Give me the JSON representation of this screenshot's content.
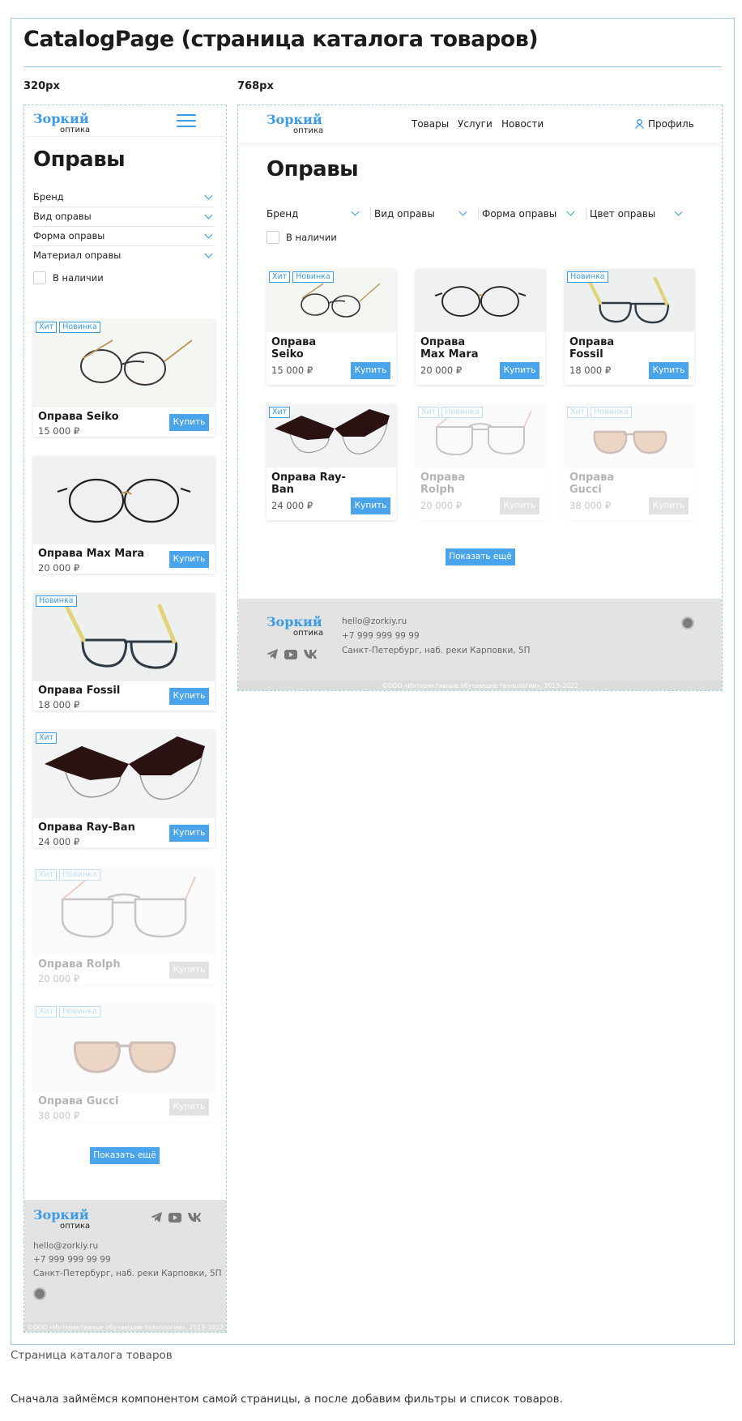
{
  "page_title": "CatalogPage (страница каталога товаров)",
  "widths": {
    "mobile": "320px",
    "tablet": "768px"
  },
  "logo": {
    "name": "Зоркий",
    "sub": "оптика"
  },
  "heading": "Оправы",
  "nav": [
    "Товары",
    "Услуги",
    "Новости"
  ],
  "profile": "Профиль",
  "filters_mobile": [
    "Бренд",
    "Вид оправы",
    "Форма оправы",
    "Материал оправы"
  ],
  "filters_tablet": [
    "Бренд",
    "Вид оправы",
    "Форма оправы",
    "Цвет оправы"
  ],
  "in_stock": "В наличии",
  "buy_label": "Купить",
  "show_more": "Показать ещё",
  "products": [
    {
      "name": "Оправа Seiko",
      "price": "15 000 ₽",
      "badges": [
        "Хит",
        "Новинка"
      ],
      "available": true
    },
    {
      "name": "Оправа Max Mara",
      "price": "20 000 ₽",
      "badges": [],
      "available": true
    },
    {
      "name": "Оправа Fossil",
      "price": "18 000 ₽",
      "badges": [
        "Новинка"
      ],
      "available": true
    },
    {
      "name": "Оправа Ray-Ban",
      "price": "24 000 ₽",
      "badges": [
        "Хит"
      ],
      "available": true
    },
    {
      "name": "Оправа Rolph",
      "price": "20 000 ₽",
      "badges": [
        "Хит",
        "Новинка"
      ],
      "available": false
    },
    {
      "name": "Оправа Gucci",
      "price": "38 000 ₽",
      "badges": [
        "Хит",
        "Новинка"
      ],
      "available": false
    }
  ],
  "tablet_names": [
    [
      "Оправа",
      "Seiko"
    ],
    [
      "Оправа",
      "Max Mara"
    ],
    [
      "Оправа",
      "Fossil"
    ],
    [
      "Оправа Ray-",
      "Ban"
    ],
    [
      "Оправа",
      "Rolph"
    ],
    [
      "Оправа",
      "Gucci"
    ]
  ],
  "footer": {
    "email": "hello@zorkiy.ru",
    "phone": "+7 999 999 99 99",
    "address": "Санкт-Петербург, наб. реки Карповки, 5П",
    "copyright": "©ООО «Интерактивные обучающие технологии», 2013–2022",
    "social": [
      "telegram-icon",
      "youtube-icon",
      "vk-icon"
    ]
  },
  "captions": {
    "figure": "Страница каталога товаров",
    "body": "Сначала займёмся компонентом самой страницы, а после добавим фильтры и список товаров."
  },
  "colors": {
    "accent": "#4aa4ec",
    "logo": "#3d9be4",
    "footer_bg": "#e3e3e3"
  }
}
